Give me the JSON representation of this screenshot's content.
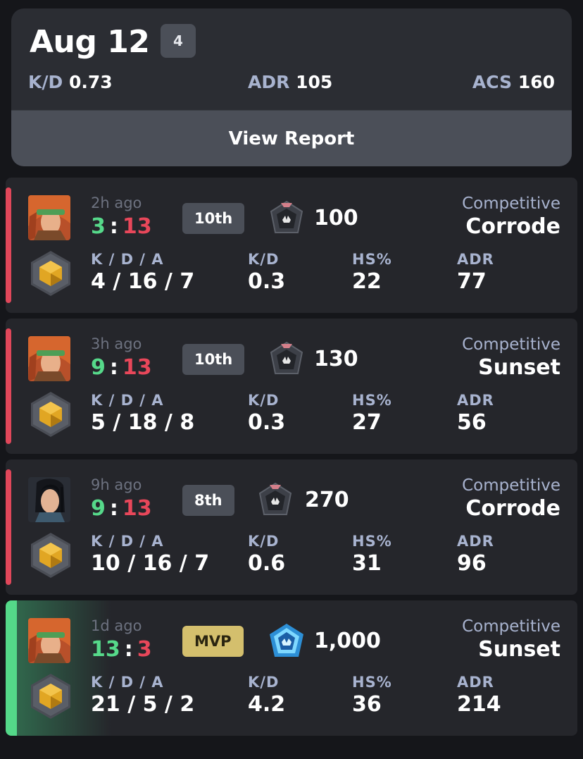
{
  "summary": {
    "date": "Aug 12",
    "match_count": "4",
    "kd_label": "K/D",
    "kd_value": "0.73",
    "adr_label": "ADR",
    "adr_value": "105",
    "acs_label": "ACS",
    "acs_value": "160",
    "view_report_label": "View Report"
  },
  "labels": {
    "kda": "K / D / A",
    "kd": "K/D",
    "hs": "HS%",
    "adr": "ADR",
    "score_separator": ":"
  },
  "colors": {
    "loss": "#e0475a",
    "win": "#54d989",
    "mvp_badge": "#d4bf6d",
    "muted_label": "#a8b3cf"
  },
  "matches": [
    {
      "result": "loss",
      "agent_icon": "agent-green-headband-icon",
      "rank_icon": "gold-rank-icon",
      "rr_icon": "dark-rank-badge-icon",
      "ago": "2h ago",
      "score_us": "3",
      "score_them": "13",
      "placement": "10th",
      "rr": "100",
      "mode": "Competitive",
      "map": "Corrode",
      "kda": "4 / 16 / 7",
      "kd": "0.3",
      "hs": "22",
      "adr": "77"
    },
    {
      "result": "loss",
      "agent_icon": "agent-green-headband-icon",
      "rank_icon": "gold-rank-icon",
      "rr_icon": "dark-rank-badge-icon",
      "ago": "3h ago",
      "score_us": "9",
      "score_them": "13",
      "placement": "10th",
      "rr": "130",
      "mode": "Competitive",
      "map": "Sunset",
      "kda": "5 / 18 / 8",
      "kd": "0.3",
      "hs": "27",
      "adr": "56"
    },
    {
      "result": "loss",
      "agent_icon": "agent-dark-hair-icon",
      "rank_icon": "gold-rank-icon",
      "rr_icon": "dark-rank-badge-icon",
      "ago": "9h ago",
      "score_us": "9",
      "score_them": "13",
      "placement": "8th",
      "rr": "270",
      "mode": "Competitive",
      "map": "Corrode",
      "kda": "10 / 16 / 7",
      "kd": "0.6",
      "hs": "31",
      "adr": "96"
    },
    {
      "result": "win",
      "agent_icon": "agent-green-headband-icon",
      "rank_icon": "gold-rank-icon",
      "rr_icon": "blue-rank-badge-icon",
      "ago": "1d ago",
      "score_us": "13",
      "score_them": "3",
      "placement": "MVP",
      "rr": "1,000",
      "mode": "Competitive",
      "map": "Sunset",
      "kda": "21 / 5 / 2",
      "kd": "4.2",
      "hs": "36",
      "adr": "214"
    }
  ]
}
